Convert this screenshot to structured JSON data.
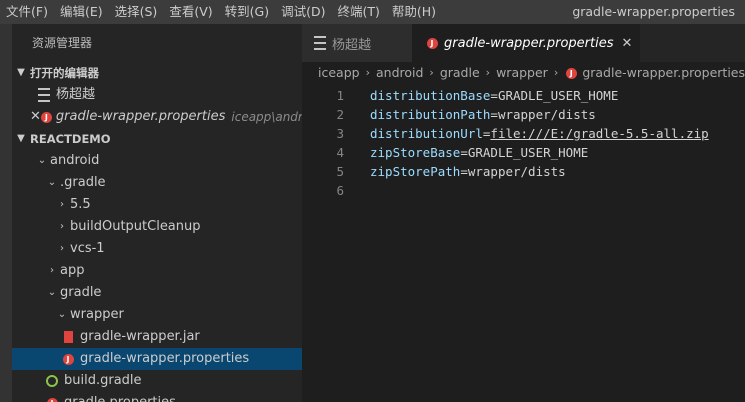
{
  "menu": [
    "文件(F)",
    "编辑(E)",
    "选择(S)",
    "查看(V)",
    "转到(G)",
    "调试(D)",
    "终端(T)",
    "帮助(H)"
  ],
  "window_title": "gradle-wrapper.properties",
  "sidebar": {
    "title": "资源管理器",
    "open_editors": {
      "header": "打开的编辑器",
      "items": [
        {
          "name": "杨超越",
          "path": ""
        },
        {
          "name": "gradle-wrapper.properties",
          "path": "iceapp\\androi..."
        }
      ]
    },
    "project": {
      "header": "REACTDEMO",
      "tree": [
        {
          "label": "android"
        },
        {
          "label": ".gradle"
        },
        {
          "label": "5.5"
        },
        {
          "label": "buildOutputCleanup"
        },
        {
          "label": "vcs-1"
        },
        {
          "label": "app"
        },
        {
          "label": "gradle"
        },
        {
          "label": "wrapper"
        },
        {
          "label": "gradle-wrapper.jar"
        },
        {
          "label": "gradle-wrapper.properties"
        },
        {
          "label": "build.gradle"
        },
        {
          "label": "gradle.properties"
        }
      ]
    }
  },
  "tabs": [
    {
      "label": "杨超越"
    },
    {
      "label": "gradle-wrapper.properties"
    }
  ],
  "breadcrumb": [
    "iceapp",
    "android",
    "gradle",
    "wrapper",
    "gradle-wrapper.properties"
  ],
  "code": [
    {
      "ln": "1",
      "key": "distributionBase",
      "eq": "=",
      "val": "GRADLE_USER_HOME"
    },
    {
      "ln": "2",
      "key": "distributionPath",
      "eq": "=",
      "val": "wrapper/dists"
    },
    {
      "ln": "3",
      "key": "distributionUrl",
      "eq": "=",
      "val": "file:///E:/gradle-5.5-all.zip"
    },
    {
      "ln": "4",
      "key": "zipStoreBase",
      "eq": "=",
      "val": "GRADLE_USER_HOME"
    },
    {
      "ln": "5",
      "key": "zipStorePath",
      "eq": "=",
      "val": "wrapper/dists"
    },
    {
      "ln": "6",
      "key": "",
      "eq": "",
      "val": ""
    }
  ],
  "colors": {
    "accent": "#094771",
    "key": "#9cdcfe",
    "properties_icon": "#e0443e",
    "gradle_icon": "#8bc34a"
  }
}
